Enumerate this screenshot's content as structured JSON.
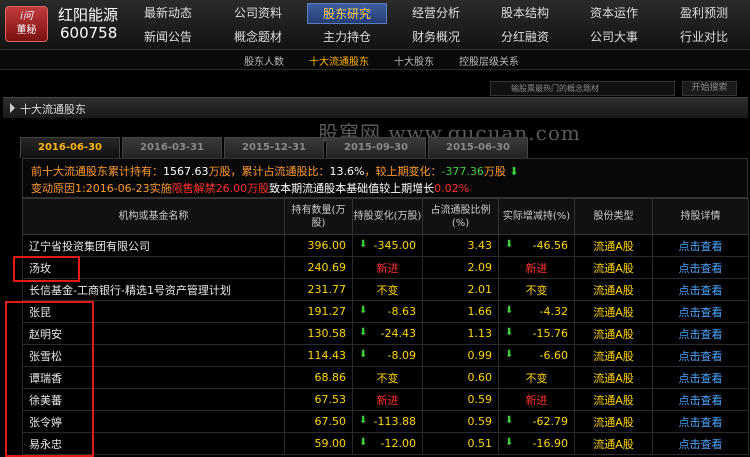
{
  "header": {
    "logo_line1": "i问",
    "logo_line2": "董秘",
    "stock_name": "红阳能源",
    "stock_code": "600758"
  },
  "nav": [
    {
      "top": "最新动态",
      "bottom": "新闻公告"
    },
    {
      "top": "公司资料",
      "bottom": "概念题材"
    },
    {
      "top": "股东研究",
      "bottom": "主力持仓"
    },
    {
      "top": "经营分析",
      "bottom": "财务概况"
    },
    {
      "top": "股本结构",
      "bottom": "分红融资"
    },
    {
      "top": "资本运作",
      "bottom": "公司大事"
    },
    {
      "top": "盈利预测",
      "bottom": "行业对比"
    }
  ],
  "subnav": [
    "股东人数",
    "十大流通股东",
    "十大股东",
    "控股层级关系"
  ],
  "search": {
    "placeholder": "输股票最热门的概念题材",
    "button": "开始搜索"
  },
  "section_title": "十大流通股东",
  "watermark": "股窜网 www.gucuan.com",
  "tabs": [
    "2016-06-30",
    "2016-03-31",
    "2015-12-31",
    "2015-09-30",
    "2015-06-30"
  ],
  "summary": {
    "p1": "前十大流通股东累计持有：",
    "v1": "1567.63",
    "p2": "万股，累计占流通股比：",
    "v2": "13.6%",
    "p3": "，较上期变化：",
    "v3": "-377.36",
    "p4": "万股",
    "arrow": "⬇",
    "q1": "变动原因1:2016-06-23实施",
    "q2": "限售解禁26.00万股",
    "q3": "致本期流通股本基础值较上期增长",
    "q4": "0.02%"
  },
  "columns": [
    "机构或基金名称",
    "持有数量(万股)",
    "持股变化(万股)",
    "占流通股比例(%)",
    "实际增减持(%)",
    "股份类型",
    "持股详情"
  ],
  "rows": [
    {
      "name": "辽宁省投资集团有限公司",
      "qty": "396.00",
      "change": "-345.00",
      "ratio": "3.43",
      "actual": "-46.56",
      "type": "流通A股",
      "detail": "点击查看"
    },
    {
      "name": "汤玫",
      "qty": "240.69",
      "change": "新进",
      "ratio": "2.09",
      "actual": "新进",
      "type": "流通A股",
      "detail": "点击查看"
    },
    {
      "name": "长信基金-工商银行-精选1号资产管理计划",
      "qty": "231.77",
      "change": "不变",
      "ratio": "2.01",
      "actual": "不变",
      "type": "流通A股",
      "detail": "点击查看"
    },
    {
      "name": "张昆",
      "qty": "191.27",
      "change": "-8.63",
      "ratio": "1.66",
      "actual": "-4.32",
      "type": "流通A股",
      "detail": "点击查看"
    },
    {
      "name": "赵明安",
      "qty": "130.58",
      "change": "-24.43",
      "ratio": "1.13",
      "actual": "-15.76",
      "type": "流通A股",
      "detail": "点击查看"
    },
    {
      "name": "张雪松",
      "qty": "114.43",
      "change": "-8.09",
      "ratio": "0.99",
      "actual": "-6.60",
      "type": "流通A股",
      "detail": "点击查看"
    },
    {
      "name": "谭瑞香",
      "qty": "68.86",
      "change": "不变",
      "ratio": "0.60",
      "actual": "不变",
      "type": "流通A股",
      "detail": "点击查看"
    },
    {
      "name": "徐美蕃",
      "qty": "67.53",
      "change": "新进",
      "ratio": "0.59",
      "actual": "新进",
      "type": "流通A股",
      "detail": "点击查看"
    },
    {
      "name": "张令婷",
      "qty": "67.50",
      "change": "-113.88",
      "ratio": "0.59",
      "actual": "-62.79",
      "type": "流通A股",
      "detail": "点击查看"
    },
    {
      "name": "易永忠",
      "qty": "59.00",
      "change": "-12.00",
      "ratio": "0.51",
      "actual": "-16.90",
      "type": "流通A股",
      "detail": "点击查看"
    }
  ],
  "down_arrow": "⬇"
}
